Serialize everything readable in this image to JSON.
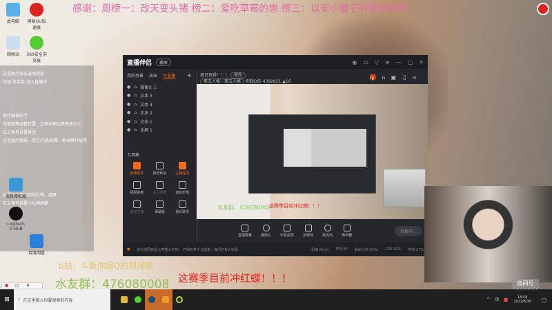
{
  "banner": "感谢：周榜一：改天变头猪 榜二：爱吃草莓的崽 榜三：以安小傻子的歌迷热热",
  "desktop_icons": [
    "此电脑",
    "网易UU加速器",
    "回收站",
    "360安全浏览器",
    "",
    "",
    "",
    "",
    "海豚模拟器",
    "",
    "Logitech G HUB",
    "",
    "",
    "百度网盘"
  ],
  "overlay_lines": [
    "这里展示水友进场消息",
    "欢迎 某某某 进入直播间",
    "按住弹幕助手",
    "左键拖拽调整位置，左键拉伸边框改变大小",
    "右上角有设置按钮",
    "这里展示弹幕、禁言开通/续费、粉丝牌升级等",
    "这里展示你收到的礼物、道具",
    "右上角可设置小礼物屏蔽"
  ],
  "app": {
    "name": "直播伴侣",
    "mode": "横屏",
    "tabs": [
      "我的场景",
      "双击",
      "可直播"
    ],
    "layers": [
      "摄像头 1",
      "文本 3",
      "文本 4",
      "文本 2",
      "文本 1",
      "全屏 1"
    ],
    "toolbox_title": "工具箱",
    "tools": [
      "弹幕助手",
      "房管助手",
      "主播任务",
      "视频连麦",
      "多人连麦",
      "虚拟形象",
      "虚拟主播",
      "弹幕姬",
      "歌词助手"
    ],
    "stream_title": "周日双排！！！",
    "edit_label": "修改",
    "category": "第五人格 - 第五人格",
    "streamer": "你超Q的",
    "room_id": "4392821",
    "popularity": "16",
    "preview_qq": "水友群：476080008",
    "preview_red": "这赛季目前冲红蝶！！！",
    "toolbar": [
      "直播屏幕",
      "摄像头",
      "手机投屏",
      "多媒体",
      "麦克风",
      "扬声器"
    ],
    "live_button": "连接中...",
    "notice": "综合流同新星公司盛大开启！ 开播吃拿千元现金，每周还有大惊喜",
    "stats": [
      "码率:0kb/s",
      "FPS:30",
      "丢帧:0(0.00%)",
      "CPU:10%",
      "内存:27%"
    ]
  },
  "room": {
    "label": "房间号",
    "id": "4392821"
  },
  "bili": "b站：斗鱼你超Q的视频姐",
  "qq_group": "水友群：476080008",
  "slogan": "这赛季目前冲红蝶！！！",
  "taskbar": {
    "search_placeholder": "在这里输入你要搜索的内容",
    "ime": "中",
    "time": "18:59",
    "date": "2021/6/30"
  }
}
